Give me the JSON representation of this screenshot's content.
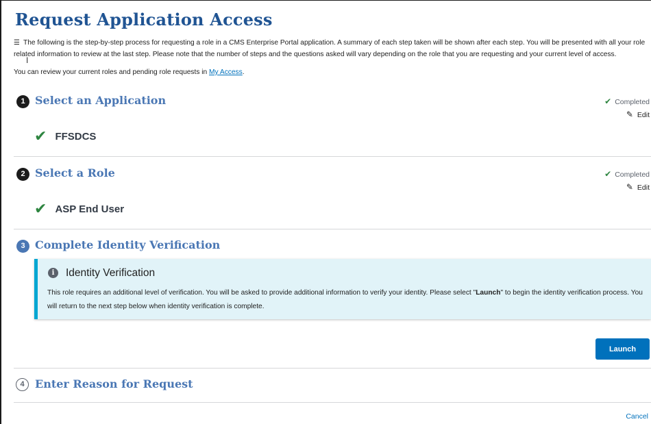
{
  "page": {
    "title": "Request Application Access",
    "intro_text": "The following is the step-by-step process for requesting a role in a CMS Enterprise Portal application. A summary of each step taken will be shown after each step. You will be presented with all your role related information to review at the last step. Please note that the number of steps and the questions asked will vary depending on the role that you are requesting and your current level of access.",
    "roles_text": "You can review your current roles and pending role requests in ",
    "roles_link": "My Access",
    "roles_suffix": "."
  },
  "steps": [
    {
      "number": "1",
      "title": "Select an Application",
      "status": "Completed",
      "edit_label": "Edit",
      "summary": "FFSDCS"
    },
    {
      "number": "2",
      "title": "Select a Role",
      "status": "Completed",
      "edit_label": "Edit",
      "summary": "ASP End User"
    },
    {
      "number": "3",
      "title": "Complete Identity Verification",
      "alert": {
        "title": "Identity Verification",
        "body_before": "This role requires an additional level of verification. You will be asked to provide additional information to verify your identity. Please select \"",
        "body_bold": "Launch",
        "body_after": "\" to begin the identity verification process. You will return to the next step below when identity verification is complete."
      },
      "button_label": "Launch"
    },
    {
      "number": "4",
      "title": "Enter Reason for Request"
    }
  ],
  "footer": {
    "cancel_label": "Cancel"
  },
  "colors": {
    "title_blue": "#205493",
    "step_blue": "#4a77b4",
    "check_green": "#2e8540",
    "alert_bg": "#e1f3f8",
    "alert_border": "#00a6d2",
    "button_blue": "#0071bc"
  },
  "icons": {
    "intro": "list-icon",
    "completed": "check-icon",
    "edit": "pencil-icon",
    "summary": "check-icon",
    "alert": "info-icon"
  }
}
